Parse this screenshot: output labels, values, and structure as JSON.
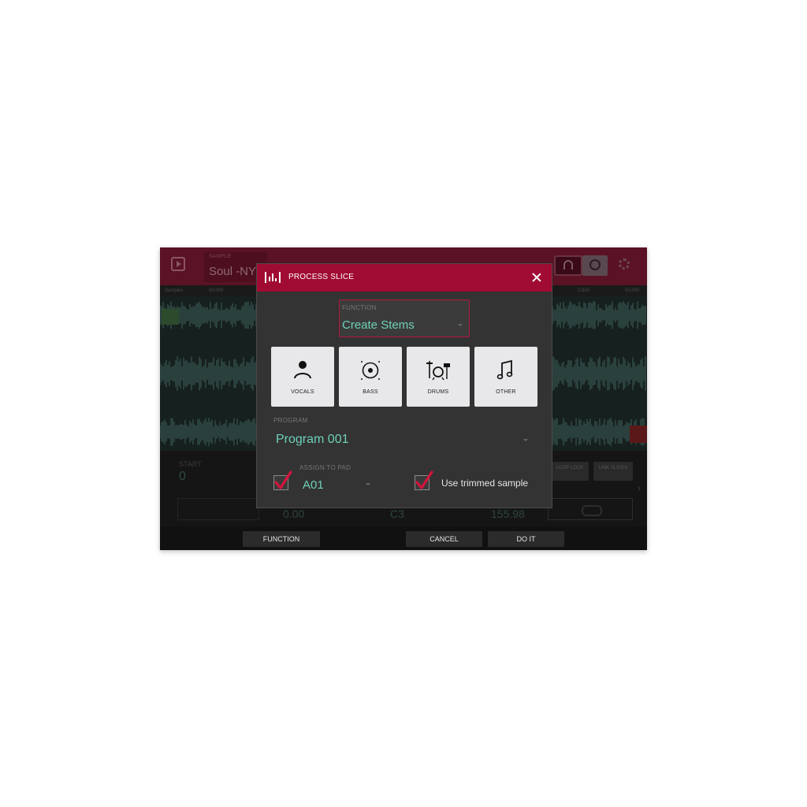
{
  "background": {
    "sample_caption": "SAMPLE",
    "sample_name": "Soul -NY S",
    "ruler_labels": [
      "Samples",
      "50,000",
      "2,800",
      "50,000"
    ],
    "start_label": "START",
    "start_value": "0",
    "loop_lock_label": "LOOP LOCK",
    "link_slices_label": "LINK SLICES",
    "bottom_values": [
      "0.00",
      "C3",
      "155.98"
    ]
  },
  "dialog": {
    "title": "PROCESS SLICE",
    "function_caption": "FUNCTION",
    "function_value": "Create Stems",
    "stems": [
      {
        "label": "VOCALS",
        "icon": "vocals-icon"
      },
      {
        "label": "BASS",
        "icon": "bass-icon"
      },
      {
        "label": "DRUMS",
        "icon": "drums-icon"
      },
      {
        "label": "OTHER",
        "icon": "other-icon"
      }
    ],
    "program_caption": "PROGRAM",
    "program_value": "Program 001",
    "assign_caption": "ASSIGN TO PAD",
    "assign_value": "A01",
    "assign_checked": true,
    "trimmed_label": "Use trimmed sample",
    "trimmed_checked": true
  },
  "softkeys": {
    "function": "FUNCTION",
    "cancel": "CANCEL",
    "do_it": "DO IT"
  },
  "colors": {
    "accent": "#a00b33",
    "value_text": "#6fd0b8",
    "check": "#d4143c"
  }
}
